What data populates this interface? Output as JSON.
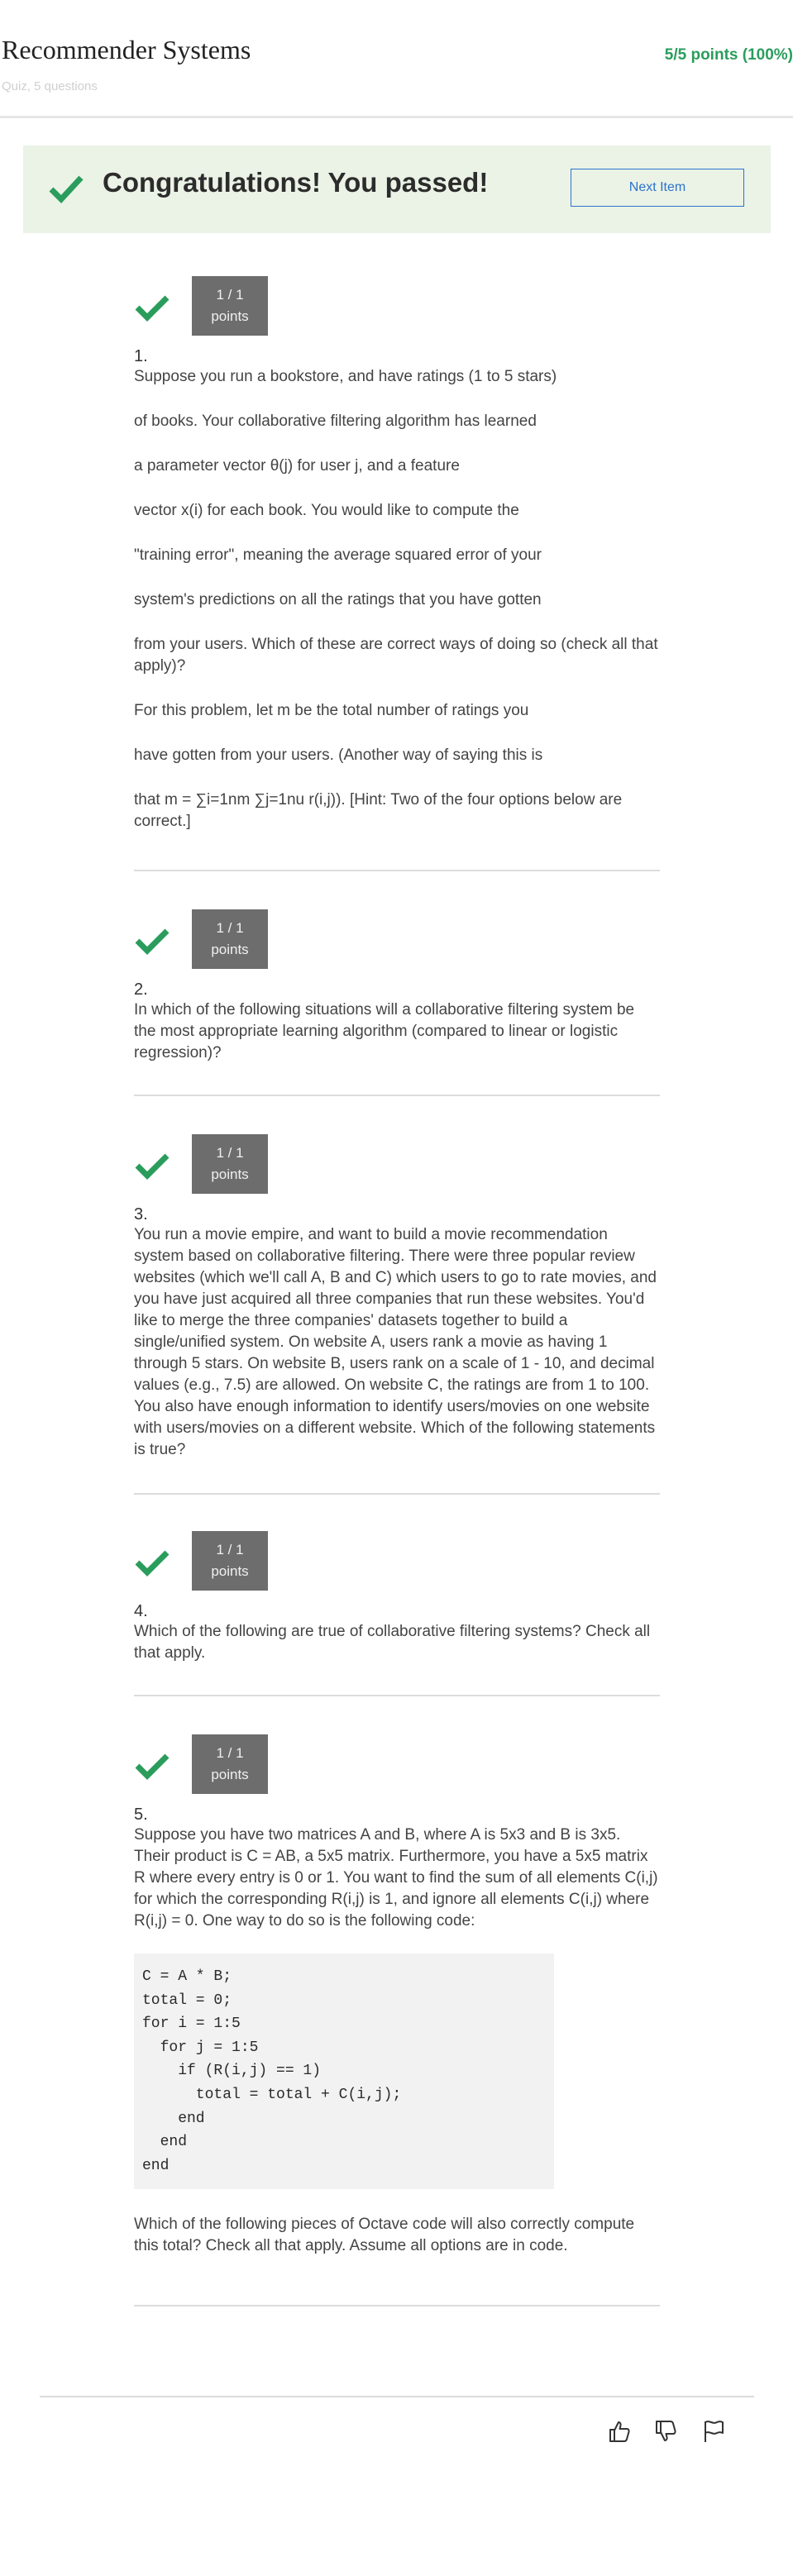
{
  "header": {
    "title": "Recommender Systems",
    "subtitle": "Quiz, 5 questions",
    "score": "5/5 points (100%)"
  },
  "banner": {
    "message": "Congratulations! You passed!",
    "next_label": "Next Item"
  },
  "questions": [
    {
      "points": "1 / 1",
      "points_label": "points",
      "number": "1.",
      "paragraphs": [
        "Suppose you run a bookstore, and have ratings (1 to 5 stars)",
        "of books. Your collaborative filtering algorithm has learned",
        "a parameter vector θ(j) for user j, and a feature",
        "vector x(i) for each book. You would like to compute the",
        "\"training error\", meaning the average squared error of your",
        "system's predictions on all the ratings that you have gotten",
        "from your users. Which of these are correct ways of doing so (check all that apply)?",
        "For this problem, let m be the total number of ratings you",
        "have gotten from your users. (Another way of saying this is",
        "that m = ∑i=1nm ∑j=1nu r(i,j)). [Hint: Two of the four options below are correct.]"
      ]
    },
    {
      "points": "1 / 1",
      "points_label": "points",
      "number": "2.",
      "paragraphs": [
        "In which of the following situations will a collaborative filtering system be the most appropriate learning algorithm (compared to linear or logistic regression)?"
      ]
    },
    {
      "points": "1 / 1",
      "points_label": "points",
      "number": "3.",
      "paragraphs": [
        "You run a movie empire, and want to build a movie recommendation system based on collaborative filtering. There were three popular review websites (which we'll call A, B and C) which users to go to rate movies, and you have just acquired all three companies that run these websites. You'd like to merge the three companies' datasets together to build a single/unified system. On website A, users rank a movie as having 1 through 5 stars. On website B, users rank on a scale of 1 - 10, and decimal values (e.g., 7.5) are allowed. On website C, the ratings are from 1 to 100. You also have enough information to identify users/movies on one website with users/movies on a different website. Which of the following statements is true?"
      ]
    },
    {
      "points": "1 / 1",
      "points_label": "points",
      "number": "4.",
      "paragraphs": [
        "Which of the following are true of collaborative filtering systems? Check all that apply."
      ]
    },
    {
      "points": "1 / 1",
      "points_label": "points",
      "number": "5.",
      "paragraphs": [
        "Suppose you have two matrices A and B, where A is 5x3 and B is 3x5. Their product is C = AB, a 5x5 matrix. Furthermore, you have a 5x5 matrix R where every entry is 0 or 1. You want to find the sum of all elements C(i,j) for which the corresponding R(i,j) is 1, and ignore all elements C(i,j) where R(i,j) = 0. One way to do so is the following code:"
      ],
      "code": "C = A * B;\ntotal = 0;\nfor i = 1:5\n  for j = 1:5\n    if (R(i,j) == 1)\n      total = total + C(i,j);\n    end\n  end\nend",
      "after": "Which of the following pieces of Octave code will also correctly compute this total? Check all that apply. Assume all options are in code."
    }
  ],
  "footer": {
    "icons": [
      "thumbs-up-icon",
      "thumbs-down-icon",
      "flag-icon"
    ]
  },
  "colors": {
    "success": "#2a9d5c",
    "banner_bg": "#eaf3e6",
    "link": "#2a73cc",
    "points_bg": "#6d6d6d"
  }
}
